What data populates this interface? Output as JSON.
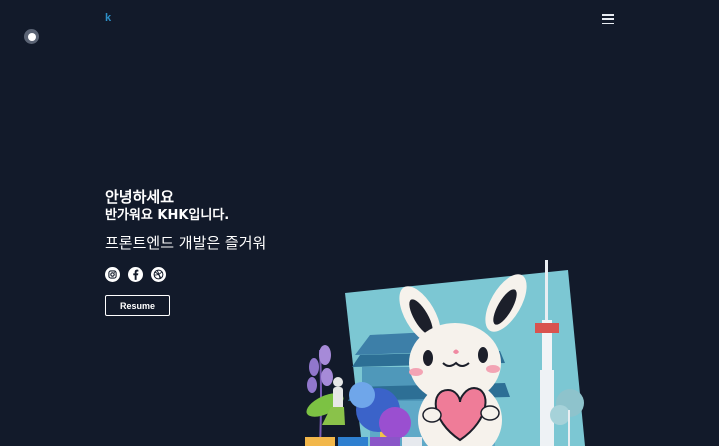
{
  "header": {
    "logo_text": "k",
    "menu_icon": "hamburger-menu-icon"
  },
  "hero": {
    "greeting_line1": "안녕하세요",
    "greeting_line2": "반가워요 KHK입니다.",
    "tagline": "프론트엔드 개발은 즐거워",
    "socials": [
      {
        "icon": "instagram-icon"
      },
      {
        "icon": "facebook-icon"
      },
      {
        "icon": "dribbble-icon"
      }
    ],
    "resume_label": "Resume"
  },
  "colors": {
    "background": "#121a2a",
    "logo": "#2d8fc7",
    "text": "#ffffff"
  }
}
